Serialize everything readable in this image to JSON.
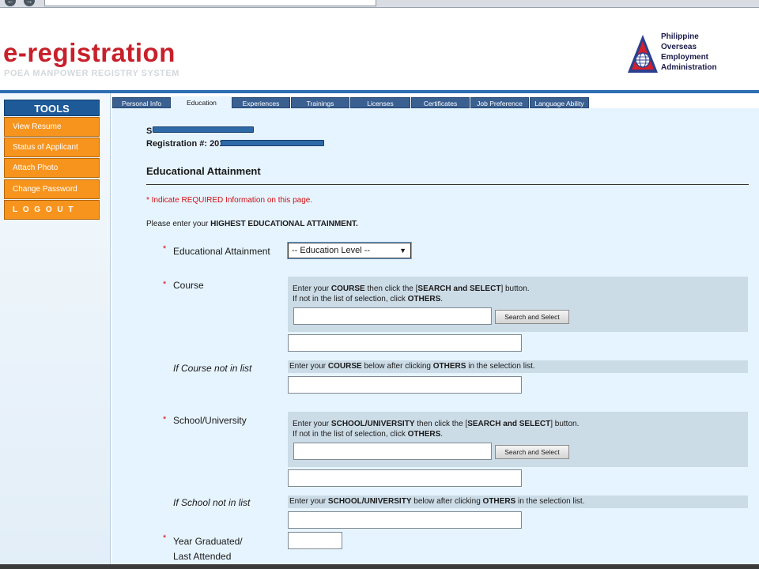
{
  "browser": {
    "back": "←",
    "forward": "→"
  },
  "header": {
    "title": "e-registration",
    "subtitle": "POEA MANPOWER REGISTRY SYSTEM",
    "agency_lines": [
      "Philippine",
      "Overseas",
      "Employment",
      "Administration"
    ],
    "logo_icon": "poea-globe-triangle-icon",
    "accent_color": "#c8202a",
    "rule_color": "#2e6eb3"
  },
  "sidebar": {
    "header": "TOOLS",
    "items": [
      {
        "label": "View Resume"
      },
      {
        "label": "Status of Applicant"
      },
      {
        "label": "Attach Photo"
      },
      {
        "label": "Change Password"
      },
      {
        "label": "L O G O U T"
      }
    ],
    "item_color": "#f7941d",
    "header_color": "#1e5a98"
  },
  "tabs": [
    {
      "label": "Personal Info"
    },
    {
      "label": "Education",
      "active": true
    },
    {
      "label": "Experiences"
    },
    {
      "label": "Trainings"
    },
    {
      "label": "Licenses"
    },
    {
      "label": "Certificates"
    },
    {
      "label": "Job Preference"
    },
    {
      "label": "Language Ability"
    }
  ],
  "content": {
    "name_prefix": "S",
    "reg_prefix": "Registration #: 2015",
    "section_title": "Educational Attainment",
    "required_note": "*  Indicate REQUIRED Information on this page.",
    "intro_prefix": "Please enter your ",
    "intro_bold": "HIGHEST EDUCATIONAL ATTAINMENT.",
    "required_marker": "*",
    "fields": {
      "attainment": {
        "label": "Educational Attainment",
        "selected": "-- Education Level --",
        "caret": "▼"
      },
      "course": {
        "label": "Course",
        "help_1a": "Enter your ",
        "help_1b": "COURSE",
        "help_1c": " then click the [",
        "help_1d": "SEARCH and SELECT",
        "help_1e": "] button.",
        "help_2a": "If not in the list of selection, click ",
        "help_2b": "OTHERS",
        "help_2c": ".",
        "button": "Search and Select"
      },
      "course_other": {
        "label": "If Course not in list",
        "hint_a": "Enter your ",
        "hint_b": "COURSE",
        "hint_c": " below after clicking ",
        "hint_d": "OTHERS",
        "hint_e": " in the selection list."
      },
      "school": {
        "label": "School/University",
        "help_1a": "Enter your ",
        "help_1b": "SCHOOL/UNIVERSITY",
        "help_1c": " then click the [",
        "help_1d": "SEARCH and SELECT",
        "help_1e": "] button.",
        "help_2a": "If not in the list of selection, click ",
        "help_2b": "OTHERS",
        "help_2c": ".",
        "button": "Search and Select"
      },
      "school_other": {
        "label": "If School not in list",
        "hint_a": "Enter your ",
        "hint_b": "SCHOOL/UNIVERSITY",
        "hint_c": " below after clicking ",
        "hint_d": "OTHERS",
        "hint_e": " in the selection list."
      },
      "year": {
        "label_1": "Year Graduated/",
        "label_2": "Last Attended"
      }
    }
  }
}
